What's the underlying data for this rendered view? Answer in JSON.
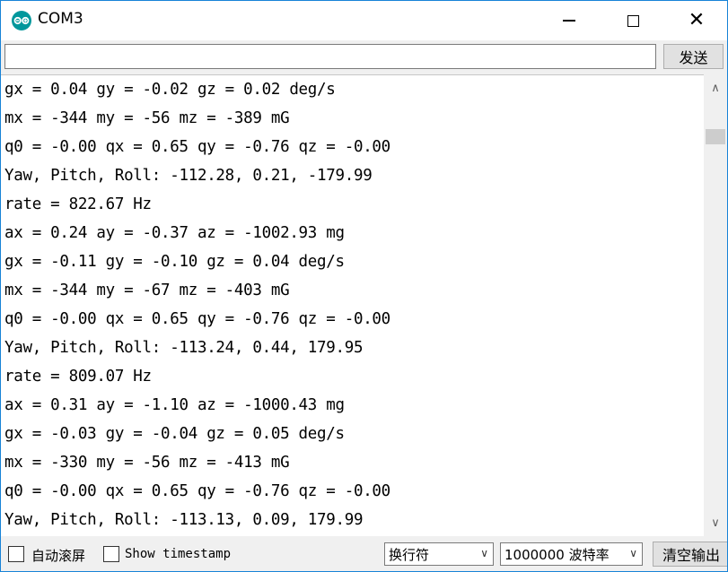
{
  "window": {
    "title": "COM3"
  },
  "send": {
    "input_value": "",
    "button_label": "发送"
  },
  "output_lines": [
    "gx = 0.04 gy = -0.02 gz = 0.02 deg/s",
    "mx = -344 my = -56 mz = -389 mG",
    "q0 = -0.00 qx = 0.65 qy = -0.76 qz = -0.00",
    "Yaw, Pitch, Roll: -112.28, 0.21, -179.99",
    "rate = 822.67 Hz",
    "ax = 0.24 ay = -0.37 az = -1002.93 mg",
    "gx = -0.11 gy = -0.10 gz = 0.04 deg/s",
    "mx = -344 my = -67 mz = -403 mG",
    "q0 = -0.00 qx = 0.65 qy = -0.76 qz = -0.00",
    "Yaw, Pitch, Roll: -113.24, 0.44, 179.95",
    "rate = 809.07 Hz",
    "ax = 0.31 ay = -1.10 az = -1000.43 mg",
    "gx = -0.03 gy = -0.04 gz = 0.05 deg/s",
    "mx = -330 my = -56 mz = -413 mG",
    "q0 = -0.00 qx = 0.65 qy = -0.76 qz = -0.00",
    "Yaw, Pitch, Roll: -113.13, 0.09, 179.99"
  ],
  "bottom": {
    "autoscroll_label": "自动滚屏",
    "timestamp_label": "Show timestamp",
    "line_ending": "换行符",
    "baud_rate": "1000000 波特率",
    "clear_label": "清空输出"
  },
  "icons": {
    "app": "arduino-logo-icon",
    "scroll_up": "chevron-up-icon",
    "scroll_down": "chevron-down-icon",
    "dropdown": "chevron-down-icon"
  },
  "colors": {
    "app_icon": "#00979c",
    "window_border": "#1883d7"
  }
}
